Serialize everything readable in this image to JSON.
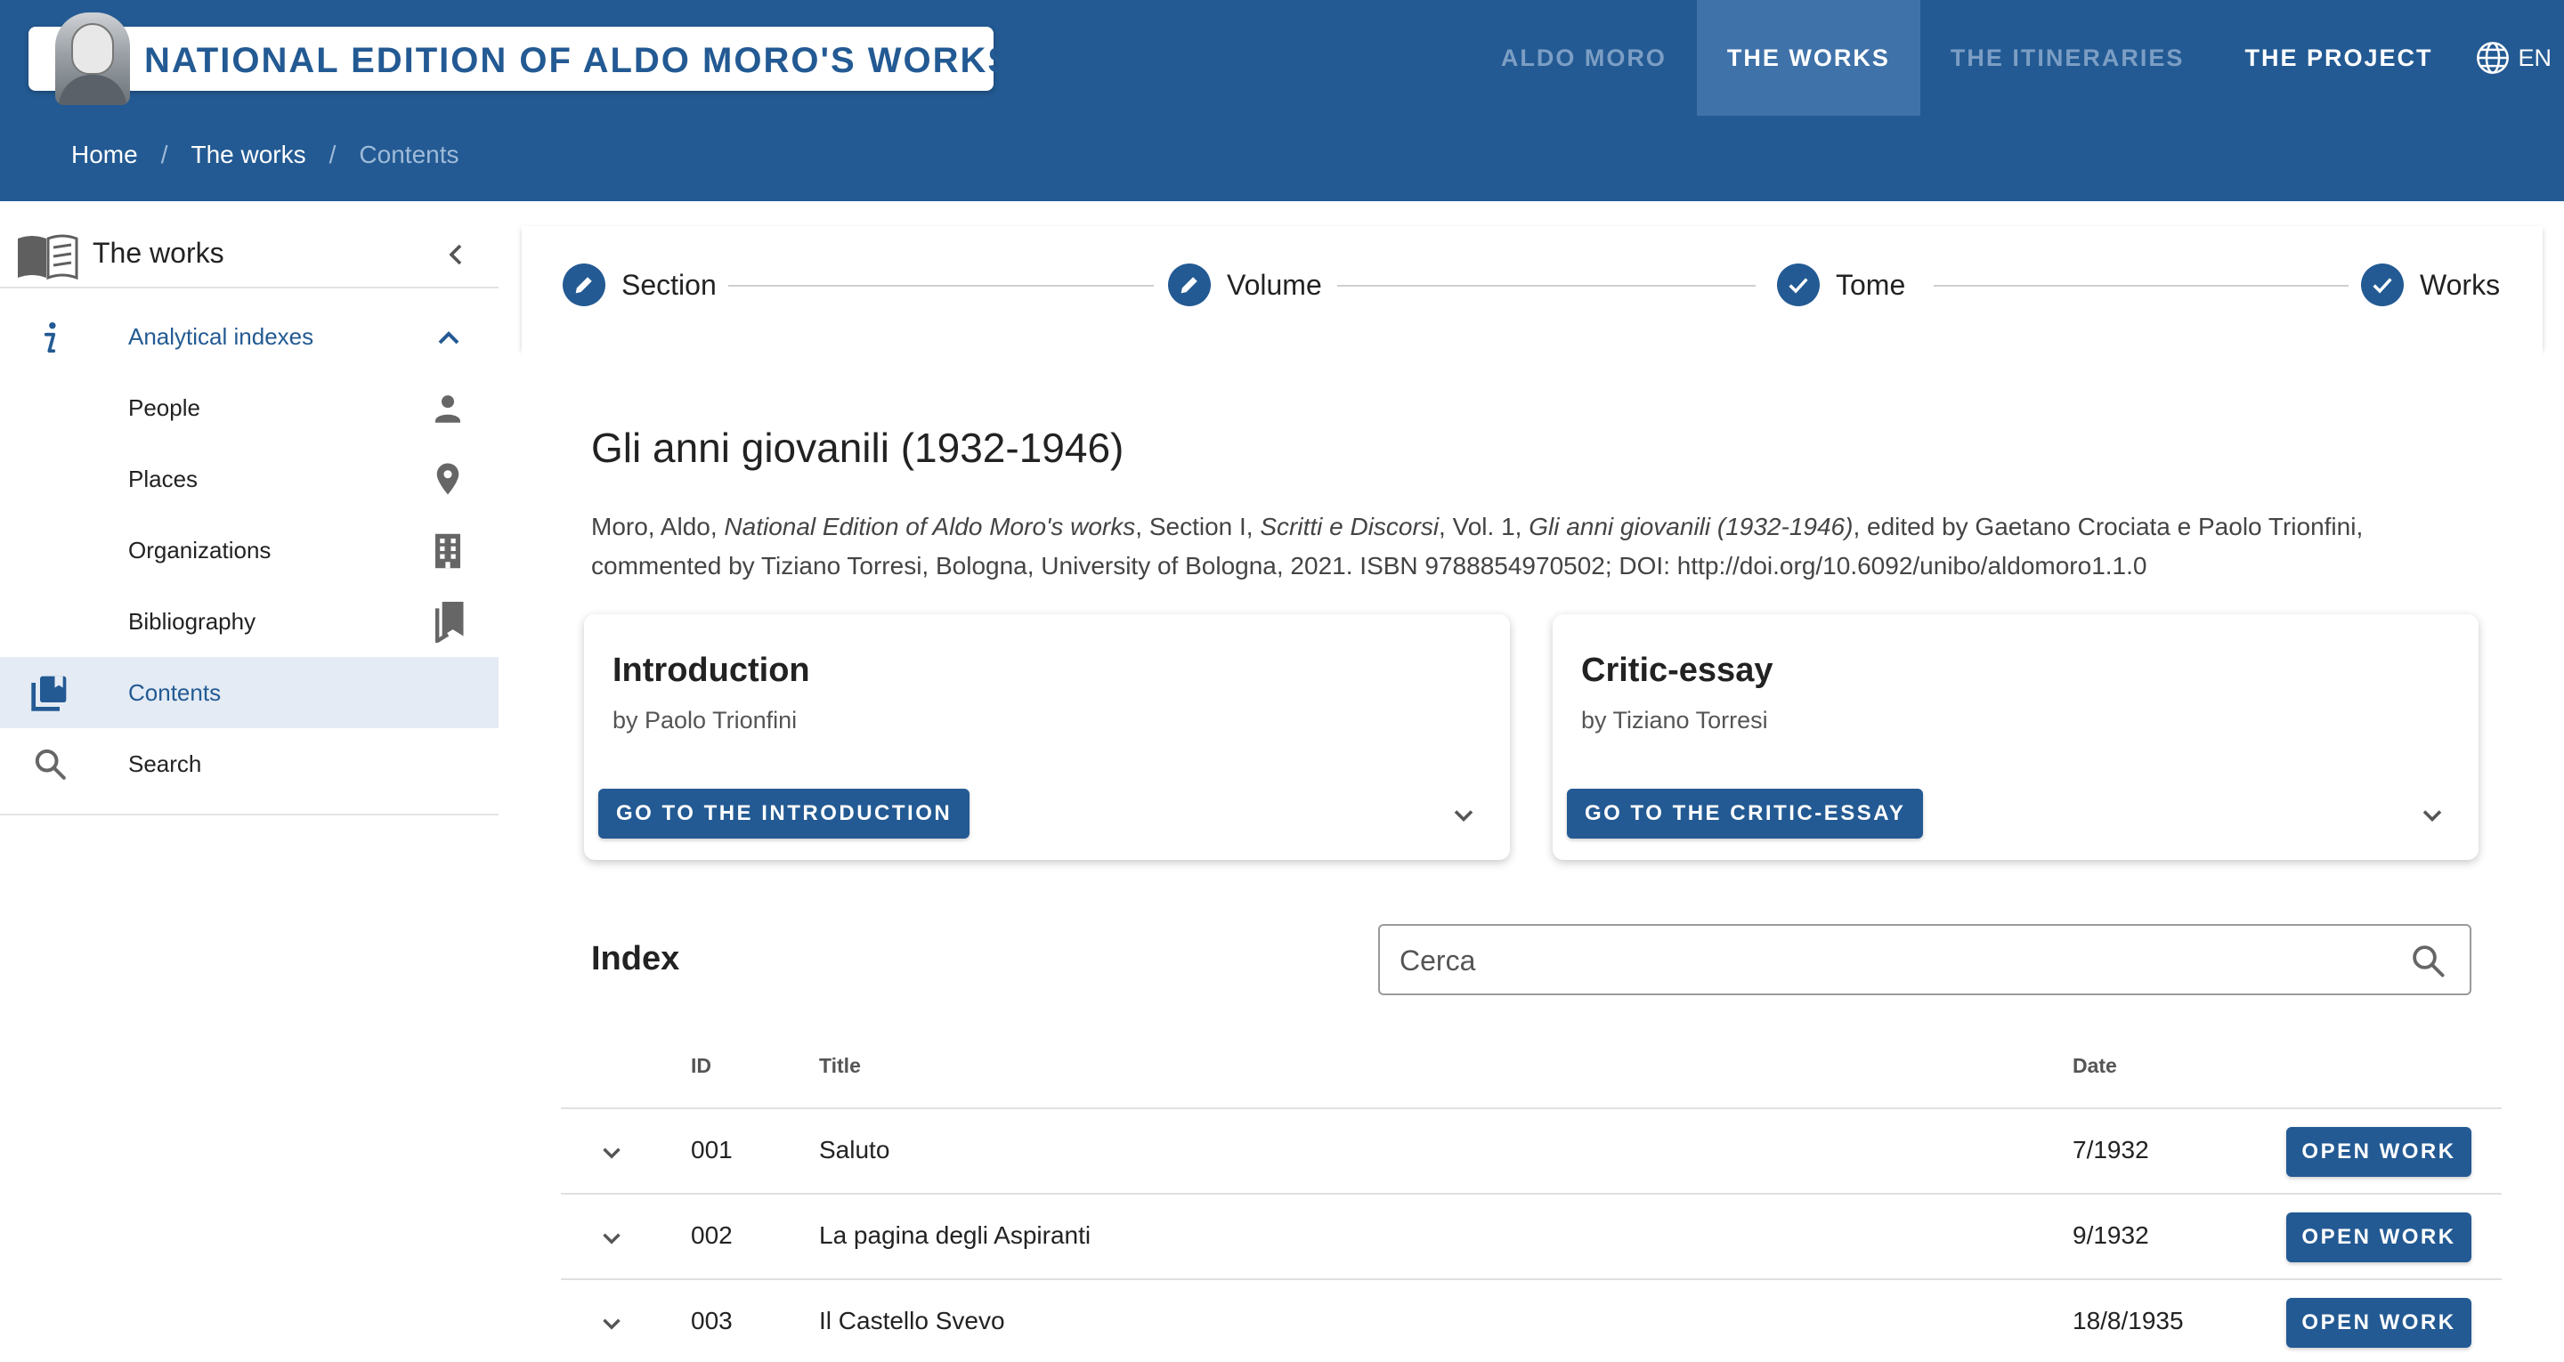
{
  "header": {
    "site_title": "NATIONAL EDITION OF ALDO MORO'S WORKS",
    "nav": [
      {
        "label": "ALDO MORO"
      },
      {
        "label": "THE WORKS"
      },
      {
        "label": "THE ITINERARIES"
      },
      {
        "label": "THE PROJECT"
      }
    ],
    "language": "EN",
    "breadcrumb": [
      {
        "label": "Home"
      },
      {
        "label": "The works"
      },
      {
        "label": "Contents"
      }
    ]
  },
  "sidebar": {
    "title": "The works",
    "items": [
      {
        "label": "Analytical indexes",
        "icon": "info-icon"
      },
      {
        "label": "People",
        "icon": "person-icon"
      },
      {
        "label": "Places",
        "icon": "location-pin-icon"
      },
      {
        "label": "Organizations",
        "icon": "building-icon"
      },
      {
        "label": "Bibliography",
        "icon": "bookmarks-icon"
      },
      {
        "label": "Contents",
        "icon": "library-books-icon"
      },
      {
        "label": "Search",
        "icon": "search-icon"
      }
    ]
  },
  "stepper": {
    "steps": [
      {
        "label": "Section",
        "icon": "pencil-icon"
      },
      {
        "label": "Volume",
        "icon": "pencil-icon"
      },
      {
        "label": "Tome",
        "icon": "check-icon"
      },
      {
        "label": "Works",
        "icon": "check-icon"
      }
    ]
  },
  "volume": {
    "title": "Gli anni giovanili (1932-1946)",
    "citation": {
      "p1": "Moro, Aldo, ",
      "i1": "National Edition of Aldo Moro's works",
      "p2": ", Section I, ",
      "i2": "Scritti e Discorsi",
      "p3": ", Vol. 1, ",
      "i3": "Gli anni giovanili (1932-1946)",
      "p4": ", edited by Gaetano Crociata e Paolo Trionfini, commented by Tiziano Torresi, Bologna, University of Bologna, 2021. ISBN 9788854970502; DOI: http://doi.org/10.6092/unibo/aldomoro1.1.0"
    }
  },
  "cards": [
    {
      "title": "Introduction",
      "by": "by Paolo Trionfini",
      "button": "GO TO THE INTRODUCTION"
    },
    {
      "title": "Critic-essay",
      "by": "by Tiziano Torresi",
      "button": "GO TO THE CRITIC-ESSAY"
    }
  ],
  "index": {
    "title": "Index",
    "search_placeholder": "Cerca",
    "columns": {
      "id": "ID",
      "title": "Title",
      "date": "Date"
    },
    "open_label": "OPEN WORK",
    "rows": [
      {
        "id": "001",
        "title": "Saluto",
        "date": "7/1932"
      },
      {
        "id": "002",
        "title": "La pagina degli Aspiranti",
        "date": "9/1932"
      },
      {
        "id": "003",
        "title": "Il Castello Svevo",
        "date": "18/8/1935"
      }
    ]
  },
  "colors": {
    "primary": "#235a93",
    "nav_active": "#3f72a9",
    "nav_dim": "#7c9ec4",
    "sidebar_selected": "#e4ebf4"
  }
}
